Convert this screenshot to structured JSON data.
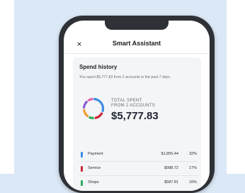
{
  "header": {
    "title": "Smart Assistant",
    "close_icon": "×"
  },
  "spend": {
    "title": "Spend history",
    "description": "You spent $5,777.83 from 2 accounts in the past 7 days.",
    "total_label_line1": "TOTAL SPENT",
    "total_label_line2": "FROM 2 ACCOUNTS",
    "total_value": "$5,777.83"
  },
  "categories": [
    {
      "name": "Payment",
      "amount": "$1,855.44",
      "pct": "32%",
      "color": "#3f8ee0"
    },
    {
      "name": "Service",
      "amount": "$988.72",
      "pct": "17%",
      "color": "#c8283a"
    },
    {
      "name": "Shops",
      "amount": "$587.81",
      "pct": "10%",
      "color": "#2faa5c"
    }
  ],
  "donut_segments": [
    {
      "color": "#3f8ee0",
      "fraction": 0.32
    },
    {
      "color": "#c8283a",
      "fraction": 0.17
    },
    {
      "color": "#2faa5c",
      "fraction": 0.1
    },
    {
      "color": "#f0a030",
      "fraction": 0.16
    },
    {
      "color": "#8b5cd6",
      "fraction": 0.15
    },
    {
      "color": "#e565b0",
      "fraction": 0.1
    }
  ]
}
